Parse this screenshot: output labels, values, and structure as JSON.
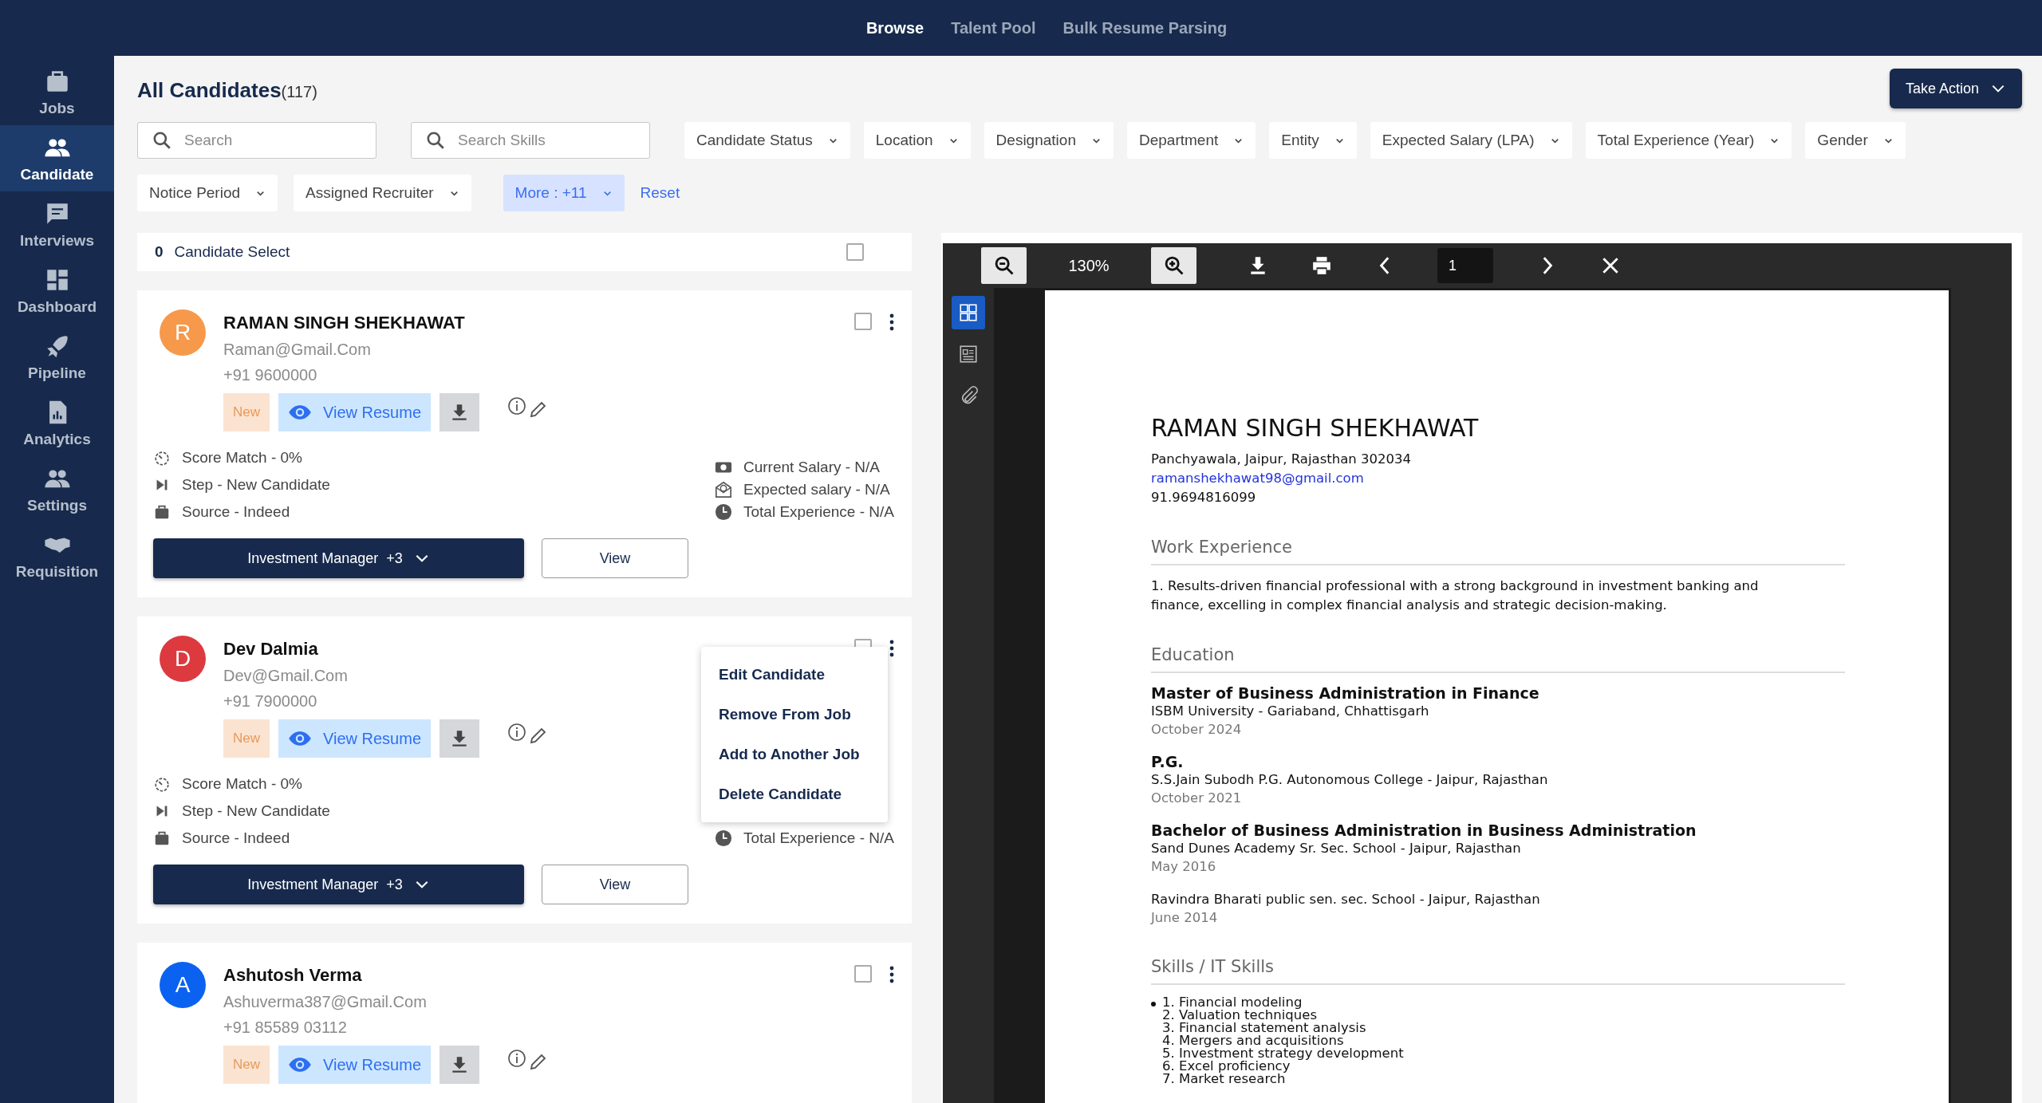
{
  "top_nav": {
    "tabs": [
      {
        "label": "Browse",
        "selected": true
      },
      {
        "label": "Talent Pool",
        "selected": false
      },
      {
        "label": "Bulk Resume Parsing",
        "selected": false
      }
    ]
  },
  "sidebar": {
    "items": [
      {
        "kind": "jobs",
        "label": "Jobs",
        "selected": false
      },
      {
        "kind": "candidate",
        "label": "Candidate",
        "selected": true
      },
      {
        "kind": "interviews",
        "label": "Interviews",
        "selected": false
      },
      {
        "kind": "dashboard",
        "label": "Dashboard",
        "selected": false
      },
      {
        "kind": "pipeline",
        "label": "Pipeline",
        "selected": false
      },
      {
        "kind": "analytics",
        "label": "Analytics",
        "selected": false
      },
      {
        "kind": "settings",
        "label": "Settings",
        "selected": false
      },
      {
        "kind": "requisition",
        "label": "Requisition",
        "selected": false
      }
    ]
  },
  "header": {
    "title": "All Candidates",
    "count": "(117)",
    "action_button": "Take Action"
  },
  "filters": {
    "search": {
      "placeholder": "Search"
    },
    "skills_search": {
      "placeholder": "Search Skills"
    },
    "dropdowns": [
      "Candidate Status",
      "Location",
      "Designation",
      "Department",
      "Entity",
      "Expected Salary (LPA)",
      "Total Experience (Year)",
      "Gender"
    ],
    "second_row": [
      "Notice Period",
      "Assigned Recruiter"
    ],
    "more": "More : +11",
    "reset": "Reset"
  },
  "selection_bar": {
    "count": "0",
    "label": "Candidate Select",
    "checked": false
  },
  "candidates": [
    {
      "initial": "R",
      "color": "#f7994a",
      "name": "RAMAN SINGH SHEKHAWAT",
      "email": "Raman@Gmail.Com",
      "phone": "+91 9600000",
      "checked": false,
      "status": "New",
      "view_resume": "View Resume",
      "stats": [
        {
          "kind": "score",
          "text": "Score Match - 0%"
        },
        {
          "kind": "step",
          "text": "Step - New Candidate"
        },
        {
          "kind": "source",
          "text": "Source - Indeed"
        }
      ],
      "salary_stats": [
        {
          "kind": "current_salary",
          "text": "Current Salary - N/A"
        },
        {
          "kind": "expected_salary",
          "text": "Expected salary - N/A"
        },
        {
          "kind": "experience",
          "text": "Total Experience - N/A"
        }
      ],
      "job_button": "Investment Manager",
      "job_extra": "+3",
      "view_button": "View"
    },
    {
      "initial": "D",
      "color": "#dc3a3f",
      "name": "Dev Dalmia",
      "email": "Dev@Gmail.Com",
      "phone": "+91 7900000",
      "checked": false,
      "status": "New",
      "view_resume": "View Resume",
      "stats": [
        {
          "kind": "score",
          "text": "Score Match - 0%"
        },
        {
          "kind": "step",
          "text": "Step - New Candidate"
        },
        {
          "kind": "source",
          "text": "Source - Indeed"
        }
      ],
      "salary_stats": [
        {
          "kind": "experience",
          "text": "Total Experience - N/A"
        }
      ],
      "job_button": "Investment Manager",
      "job_extra": "+3",
      "view_button": "View",
      "menu": [
        "Edit Candidate",
        "Remove From Job",
        "Add to Another Job",
        "Delete Candidate"
      ]
    },
    {
      "initial": "A",
      "color": "#0c62f0",
      "name": "Ashutosh Verma",
      "email": "Ashuverma387@Gmail.Com",
      "phone": "+91 85589 03112",
      "checked": false,
      "status": "New",
      "view_resume": "View Resume"
    }
  ],
  "pdf_viewer": {
    "zoom": "130%",
    "page": "1",
    "side_tabs": [
      {
        "kind": "thumbnails",
        "selected": true
      },
      {
        "kind": "outline",
        "selected": false
      },
      {
        "kind": "attachments",
        "selected": false
      }
    ],
    "resume": {
      "name": "RAMAN SINGH SHEKHAWAT",
      "address": "Panchyawala, Jaipur, Rajasthan 302034",
      "email": "ramanshekhawat98@gmail.com",
      "phone": "91.9694816099",
      "sections": [
        {
          "kind": "paragraph",
          "title": "Work Experience",
          "text": "1. Results-driven financial professional with a strong background in investment banking and finance, excelling in complex financial analysis and strategic decision-making."
        },
        {
          "kind": "entries",
          "title": "Education",
          "entries": [
            {
              "degree": "Master of Business Administration in Finance",
              "school": "ISBM University - Gariaband, Chhattisgarh",
              "date": "October 2024"
            },
            {
              "degree": "P.G.",
              "school": "S.S.Jain Subodh P.G. Autonomous College - Jaipur, Rajasthan",
              "date": "October 2021"
            },
            {
              "degree": "Bachelor of Business Administration in Business Administration",
              "school": "Sand Dunes Academy Sr. Sec. School - Jaipur, Rajasthan",
              "date": "May 2016"
            },
            {
              "school": "Ravindra Bharati public sen. sec. School - Jaipur, Rajasthan",
              "date": "June 2014"
            }
          ]
        },
        {
          "kind": "list",
          "title": "Skills / IT Skills",
          "items": [
            "1. Financial modeling",
            "2. Valuation techniques",
            "3. Financial statement analysis",
            "4. Mergers and acquisitions",
            "5. Investment strategy development",
            "6. Excel proficiency",
            "7. Market research"
          ]
        }
      ]
    }
  }
}
